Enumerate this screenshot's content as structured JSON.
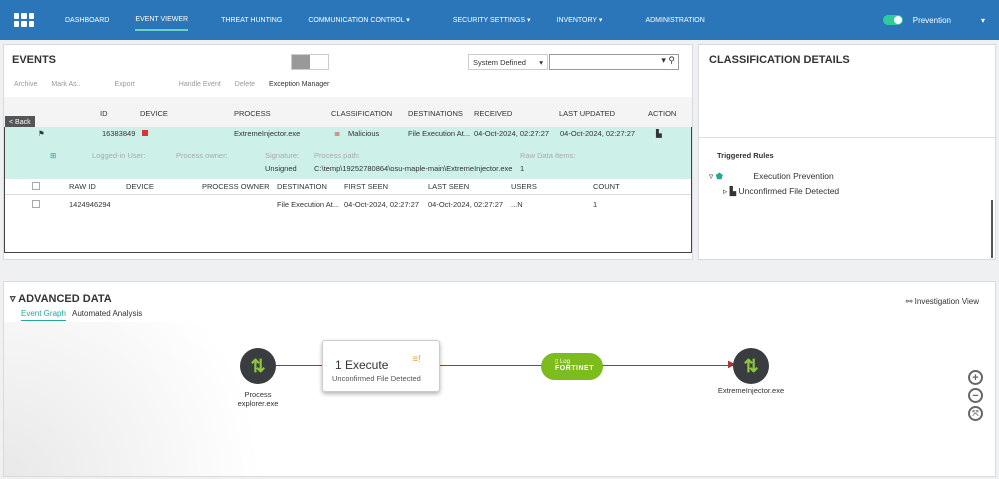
{
  "nav": {
    "items": [
      "DASHBOARD",
      "EVENT VIEWER",
      "THREAT HUNTING",
      "COMMUNICATION CONTROL ▾",
      "SECURITY SETTINGS ▾",
      "INVENTORY ▾",
      "ADMINISTRATION"
    ],
    "mode": "Prevention"
  },
  "events": {
    "title": "EVENTS",
    "filter": "System Defined",
    "search_placeholder": "",
    "toolbar": {
      "archive": "Archive",
      "mark_as": "Mark As..",
      "export": "Export",
      "handle": "Handle Event",
      "delete": "Delete",
      "exception": "Exception Manager"
    },
    "back": "< Back",
    "headers": [
      "ID",
      "DEVICE",
      "PROCESS",
      "CLASSIFICATION",
      "DESTINATIONS",
      "RECEIVED",
      "LAST UPDATED",
      "ACTION"
    ],
    "row": {
      "id": "16383849",
      "process": "ExtremeInjector.exe",
      "classification": "Malicious",
      "destination": "File Execution At...",
      "received": "04-Oct-2024, 02:27:27",
      "updated": "04-Oct-2024, 02:27:27"
    },
    "detail": {
      "logged_in": "Logged-in User:",
      "owner": "Process owner:",
      "signature_label": "Signature:",
      "signature": "Unsigned",
      "path_label": "Process path:",
      "path": "C:\\temp\\19252780864\\osu-maple-main\\ExtremeInjector.exe",
      "raw_label": "Raw Data Items:",
      "raw": "1"
    },
    "raw_headers": [
      "RAW ID",
      "DEVICE",
      "PROCESS OWNER",
      "DESTINATION",
      "FIRST SEEN",
      "LAST SEEN",
      "USERS",
      "COUNT"
    ],
    "raw_row": {
      "id": "1424946294",
      "destination": "File Execution At...",
      "first": "04-Oct-2024, 02:27:27",
      "last": "04-Oct-2024, 02:27:27",
      "users": "...N",
      "count": "1"
    }
  },
  "classification": {
    "title": "CLASSIFICATION DETAILS",
    "triggered": "Triggered Rules",
    "policy": "Execution Prevention",
    "rule": "Unconfirmed File Detected"
  },
  "advanced": {
    "title": "ADVANCED DATA",
    "tabs": [
      "Event Graph",
      "Automated Analysis"
    ],
    "investigation": "Investigation View",
    "source": "Process\nexplorer.exe",
    "source1": "Process",
    "source2": "explorer.exe",
    "exec_title": "1 Execute",
    "exec_sub": "Unconfirmed File Detected",
    "log": "Log",
    "brand": "FORTINET",
    "target": "ExtremeInjector.exe"
  }
}
